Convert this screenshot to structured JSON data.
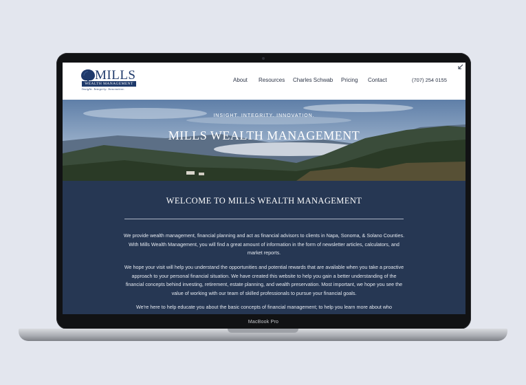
{
  "device": {
    "model_label": "MacBook Pro"
  },
  "header": {
    "logo": {
      "title": "MILLS",
      "subtitle": "WEALTH MANAGEMENT",
      "tagline": "Insight. Integrity. Innovation."
    },
    "nav": [
      "About",
      "Resources",
      "Charles Schwab",
      "Pricing",
      "Contact"
    ],
    "phone": "(707) 254 0155"
  },
  "hero": {
    "kicker": "INSIGHT. INTEGRITY. INNOVATION.",
    "title": "MILLS WEALTH MANAGEMENT"
  },
  "main": {
    "heading": "WELCOME TO MILLS WEALTH MANAGEMENT",
    "paragraphs": [
      "We provide wealth management, financial planning and act as financial advisors to clients in Napa, Sonoma, & Solano Counties. With Mills Wealth Management, you will find a great amount of information in the form of newsletter articles, calculators, and market reports.",
      "We hope your visit will help you understand the opportunities and potential rewards that are available when you take a proactive approach to your personal financial situation. We have created this website to help you gain a better understanding of the financial concepts behind investing, retirement, estate planning, and wealth preservation. Most important, we hope you see the value of working with our team of skilled professionals to pursue your financial goals.",
      "We're here to help educate you about the basic concepts of financial management; to help you learn more about who"
    ]
  },
  "colors": {
    "navy": "#263753",
    "brand_blue": "#1f3a6b",
    "background": "#e3e6ee"
  },
  "icons": {
    "expand": "expand-arrow-icon",
    "logo_tree": "tree-icon"
  }
}
